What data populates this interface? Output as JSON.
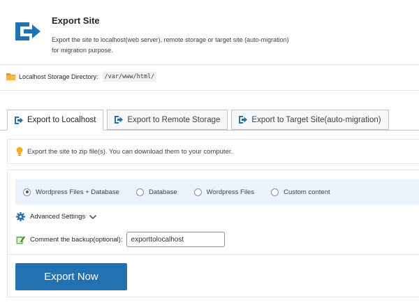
{
  "header": {
    "title": "Export Site",
    "description": "Export the site to localhost(web server), remote storage or target site (auto-migration) for migration purpose."
  },
  "storage": {
    "label": "Localhost Storage Directory:",
    "path": "/var/www/html/"
  },
  "tabs": [
    {
      "label": "Export to Localhost",
      "active": true
    },
    {
      "label": "Export to Remote Storage",
      "active": false
    },
    {
      "label": "Export to Target Site(auto-migration)",
      "active": false
    }
  ],
  "info": {
    "text": "Export the site to zip file(s). You can download them to your computer."
  },
  "options": {
    "radios": [
      {
        "label": "Wordpress Files + Database",
        "checked": true
      },
      {
        "label": "Database",
        "checked": false
      },
      {
        "label": "Wordpress Files",
        "checked": false
      },
      {
        "label": "Custom content",
        "checked": false
      }
    ],
    "advanced_label": "Advanced Settings",
    "comment_label": "Comment the backup(optional):",
    "comment_value": "exporttolocalhost",
    "export_button": "Export Now"
  },
  "colors": {
    "accent": "#2271b1",
    "radio_bar": "#eaf2fb",
    "folder": "#f0a52c",
    "bulb": "#f6b01e",
    "pen": "#6ab04c"
  }
}
